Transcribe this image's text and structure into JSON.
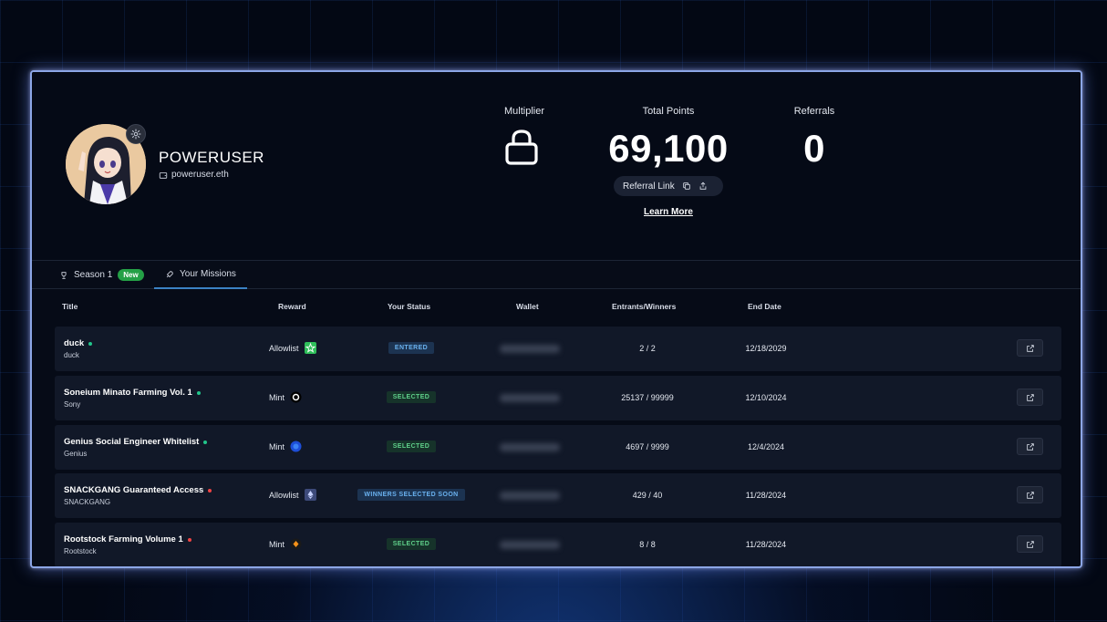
{
  "profile": {
    "username": "POWERUSER",
    "wallet": "poweruser.eth"
  },
  "stats": {
    "multiplier_label": "Multiplier",
    "total_points_label": "Total Points",
    "total_points_value": "69,100",
    "referrals_label": "Referrals",
    "referrals_value": "0",
    "referral_link_label": "Referral Link",
    "learn_more": "Learn More"
  },
  "tabs": [
    {
      "label": "Season 1",
      "badge": "New"
    },
    {
      "label": "Your Missions"
    }
  ],
  "table": {
    "headers": [
      "Title",
      "Reward",
      "Your Status",
      "Wallet",
      "Entrants/Winners",
      "End Date"
    ],
    "rows": [
      {
        "title": "duck",
        "subtitle": "duck",
        "dot_color": "#22c58b",
        "reward": "Allowlist",
        "reward_icon": "star-logo-icon",
        "status": "ENTERED",
        "entrants": "2 / 2",
        "end_date": "12/18/2029"
      },
      {
        "title": "Soneium Minato Farming Vol. 1",
        "subtitle": "Sony",
        "dot_color": "#22c58b",
        "reward": "Mint",
        "reward_icon": "soneium-logo-icon",
        "status": "SELECTED",
        "entrants": "25137 / 99999",
        "end_date": "12/10/2024"
      },
      {
        "title": "Genius Social Engineer Whitelist",
        "subtitle": "Genius",
        "dot_color": "#22c58b",
        "reward": "Mint",
        "reward_icon": "genius-logo-icon",
        "status": "SELECTED",
        "entrants": "4697 / 9999",
        "end_date": "12/4/2024"
      },
      {
        "title": "SNACKGANG Guaranteed Access",
        "subtitle": "SNACKGANG",
        "dot_color": "#ef4444",
        "reward": "Allowlist",
        "reward_icon": "ethereum-logo-icon",
        "status": "WINNERS SELECTED SOON",
        "entrants": "429 / 40",
        "end_date": "11/28/2024"
      },
      {
        "title": "Rootstock Farming Volume 1",
        "subtitle": "Rootstock",
        "dot_color": "#ef4444",
        "reward": "Mint",
        "reward_icon": "rootstock-logo-icon",
        "status": "SELECTED",
        "entrants": "8 / 8",
        "end_date": "11/28/2024"
      }
    ]
  }
}
